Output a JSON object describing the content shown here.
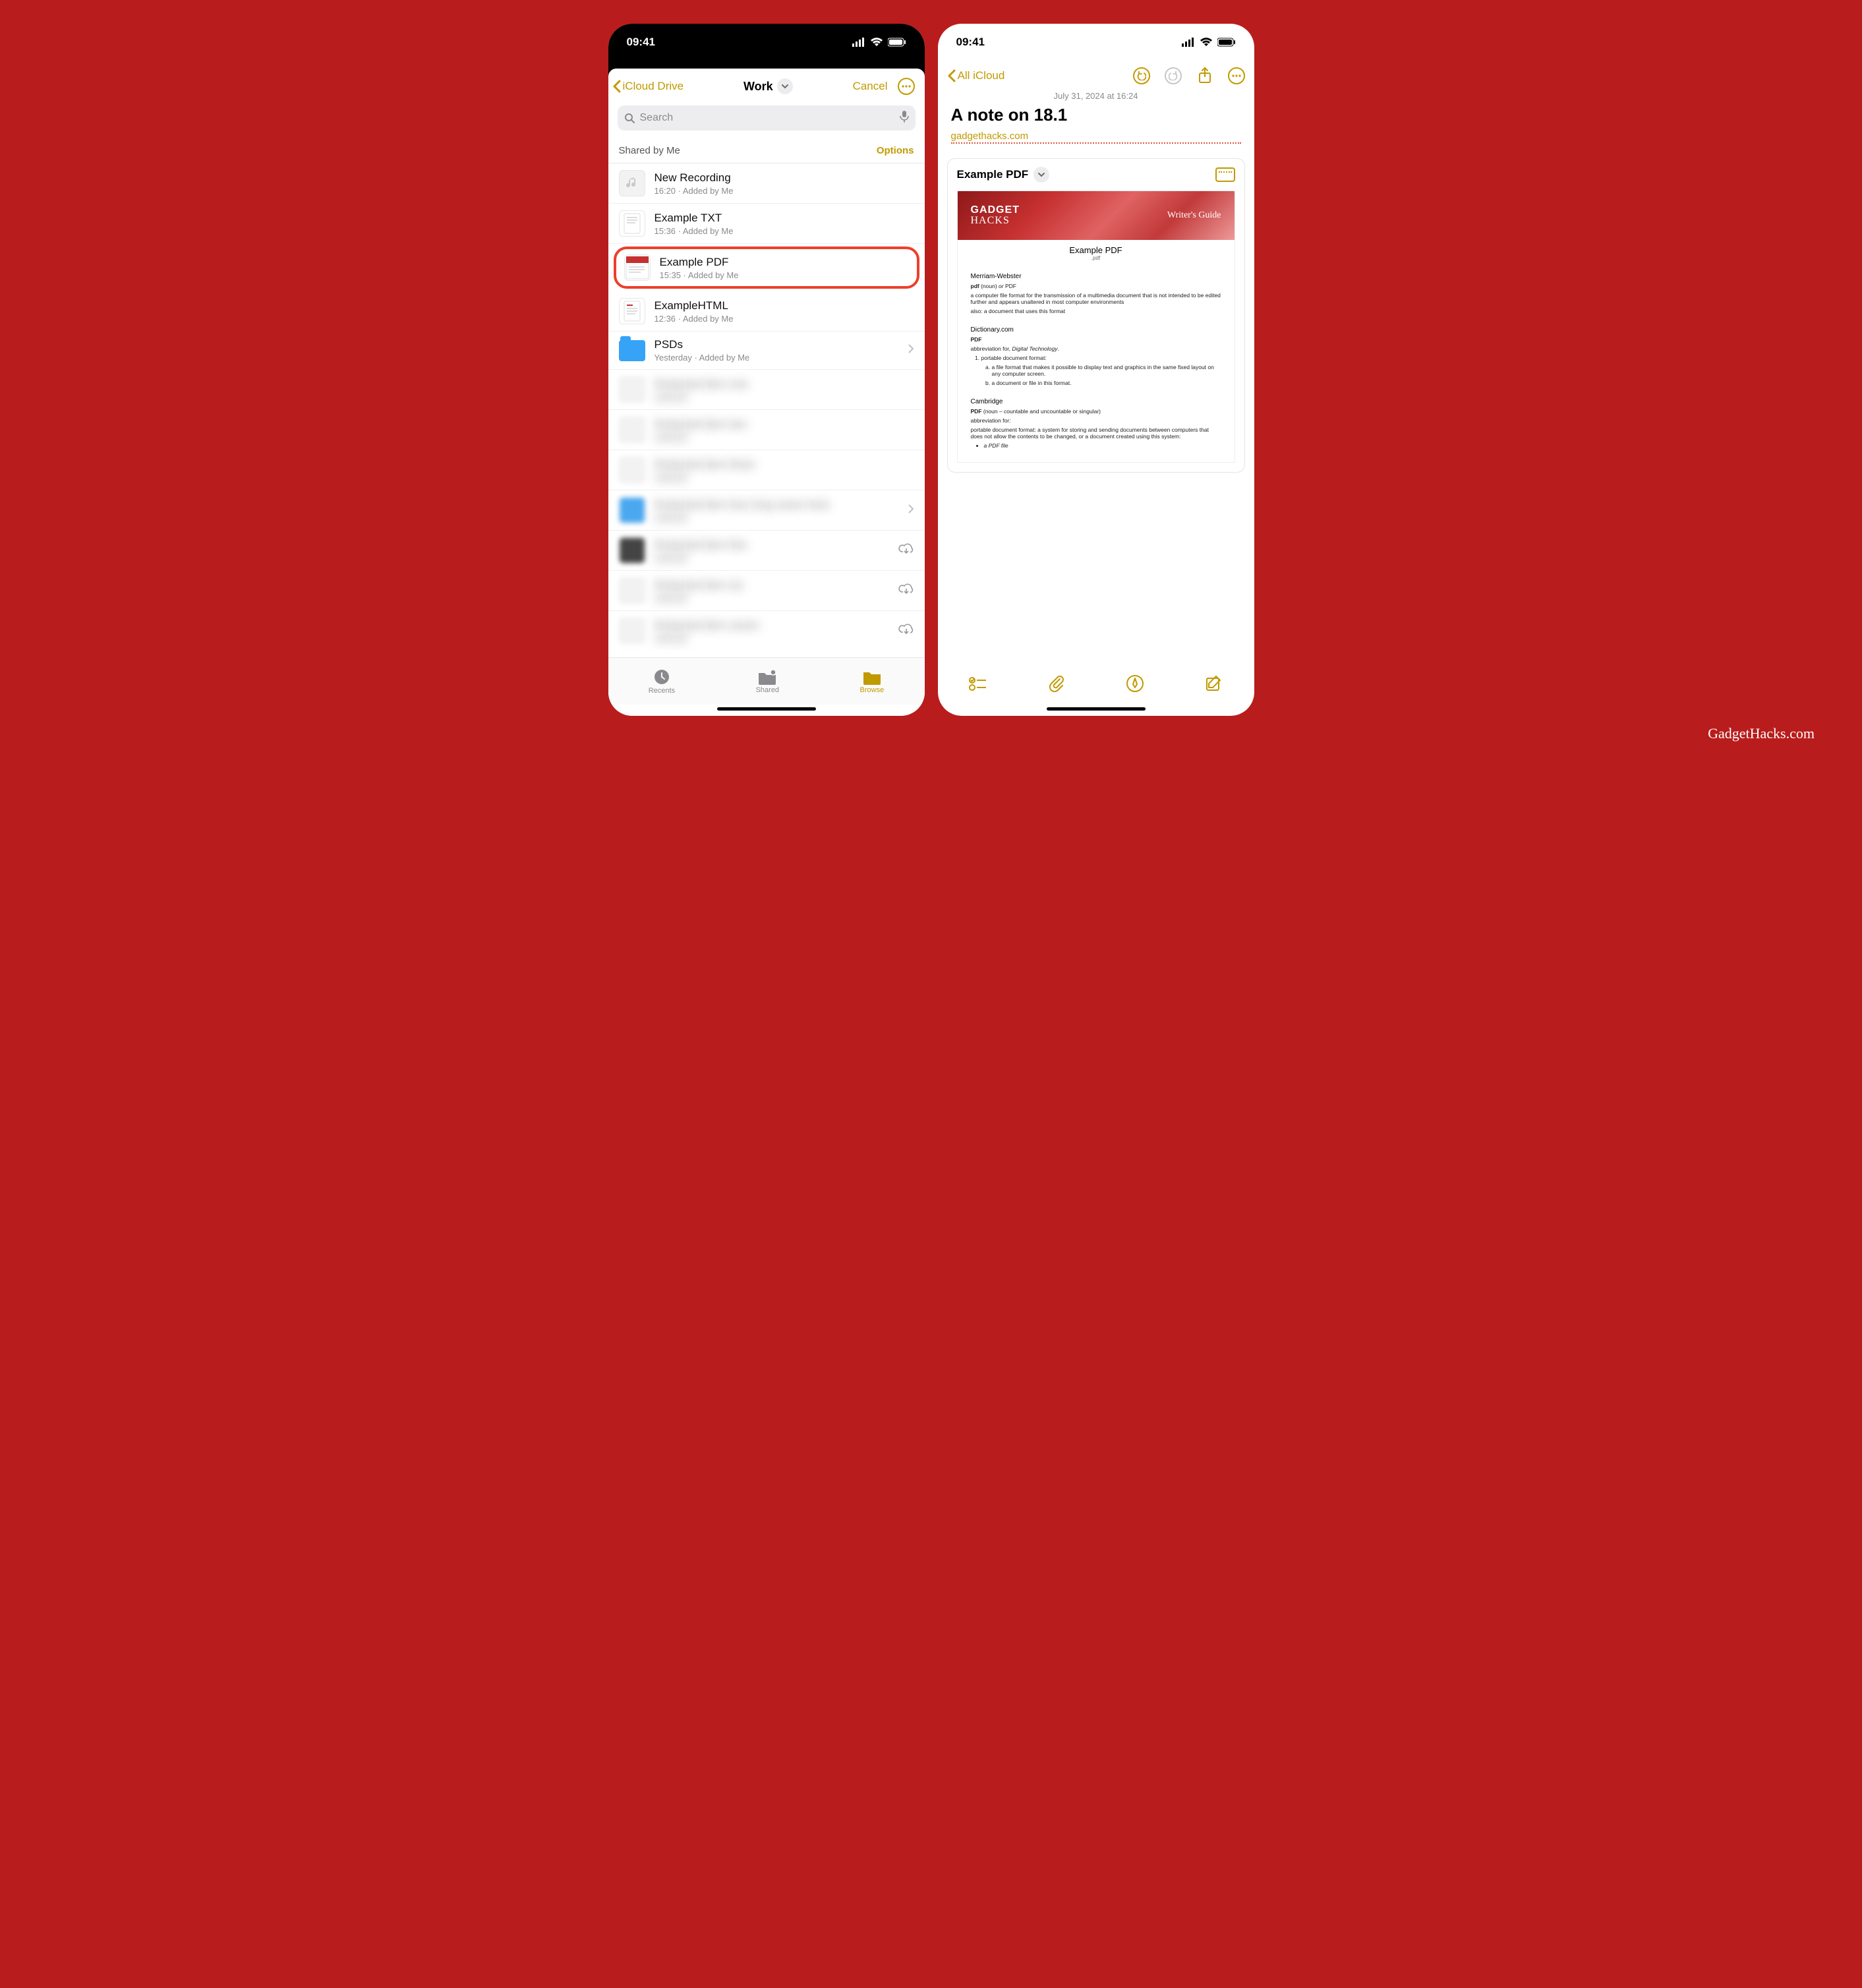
{
  "statusbar": {
    "time": "09:41"
  },
  "files": {
    "back_label": "iCloud Drive",
    "title": "Work",
    "cancel_label": "Cancel",
    "search_placeholder": "Search",
    "section_header": "Shared by Me",
    "options_label": "Options",
    "items": [
      {
        "name": "New Recording",
        "sub": "16:20 · Added by Me",
        "thumb": "audio"
      },
      {
        "name": "Example TXT",
        "sub": "15:36 · Added by Me",
        "thumb": "doc"
      },
      {
        "name": "Example PDF",
        "sub": "15:35 · Added by Me",
        "thumb": "pdf",
        "highlight": true
      },
      {
        "name": "ExampleHTML",
        "sub": "12:36 · Added by Me",
        "thumb": "doc"
      },
      {
        "name": "PSDs",
        "sub": "Yesterday · Added by Me",
        "thumb": "folder",
        "chevron": true
      }
    ],
    "blurred": [
      {
        "name": "Redacted item one",
        "sub": "redacted"
      },
      {
        "name": "Redacted item two",
        "sub": "redacted"
      },
      {
        "name": "Redacted item three",
        "sub": "redacted"
      },
      {
        "name": "Redacted item four long name here",
        "sub": "redacted",
        "chevron": true
      },
      {
        "name": "Redacted item five",
        "sub": "redacted",
        "cloud": true
      },
      {
        "name": "Redacted item six",
        "sub": "redacted",
        "cloud": true
      },
      {
        "name": "Redacted item seven",
        "sub": "redacted",
        "cloud": true
      }
    ],
    "tabs": {
      "recents": "Recents",
      "shared": "Shared",
      "browse": "Browse"
    }
  },
  "notes": {
    "back_label": "All iCloud",
    "date": "July 31, 2024 at 16:24",
    "title": "A note on 18.1",
    "link": "gadgethacks.com",
    "attachment_title": "Example PDF",
    "pdf": {
      "brand_top": "GADGET",
      "brand_bottom": "HACKS",
      "brand_right": "Writer's Guide",
      "doc_title": "Example PDF",
      "doc_sub": ".pdf",
      "mw": {
        "h": "Merriam-Webster",
        "line": "pdf (noun) or PDF",
        "p1": "a computer file format for the transmission of a multimedia document that is not intended to be edited further and appears unaltered in most computer environments",
        "p2": "also: a document that uses this format"
      },
      "dc": {
        "h": "Dictionary.com",
        "line": "PDF",
        "abbr": "abbreviation for, Digital Technology.",
        "li1": "portable document format:",
        "li1a": "a file format that makes it possible to display text and graphics in the same fixed layout on any computer screen.",
        "li1b": "a document or file in this format."
      },
      "cam": {
        "h": "Cambridge",
        "line": "PDF (noun – countable and uncountable or singular)",
        "abbr": "abbreviation for:",
        "p1": "portable document format: a system for storing and sending documents between computers that does not allow the contents to be changed, or a document created using this system:",
        "li1": "a PDF file"
      }
    }
  },
  "watermark": "GadgetHacks.com"
}
